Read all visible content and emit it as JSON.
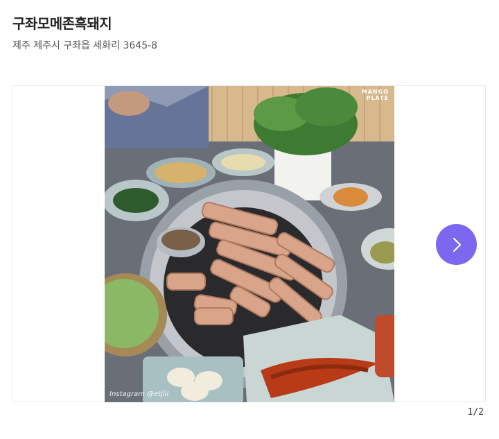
{
  "restaurant": {
    "name": "구좌모메존흑돼지",
    "address": "제주 제주시 구좌읍 세화리 3645-8"
  },
  "gallery": {
    "watermark_line1": "MANGO",
    "watermark_line2": "PLATE",
    "photo_credit": "Instagram @etjiii",
    "current_page": "1/2",
    "next_icon": "chevron-right-icon",
    "accent_color": "#7b68ee"
  }
}
